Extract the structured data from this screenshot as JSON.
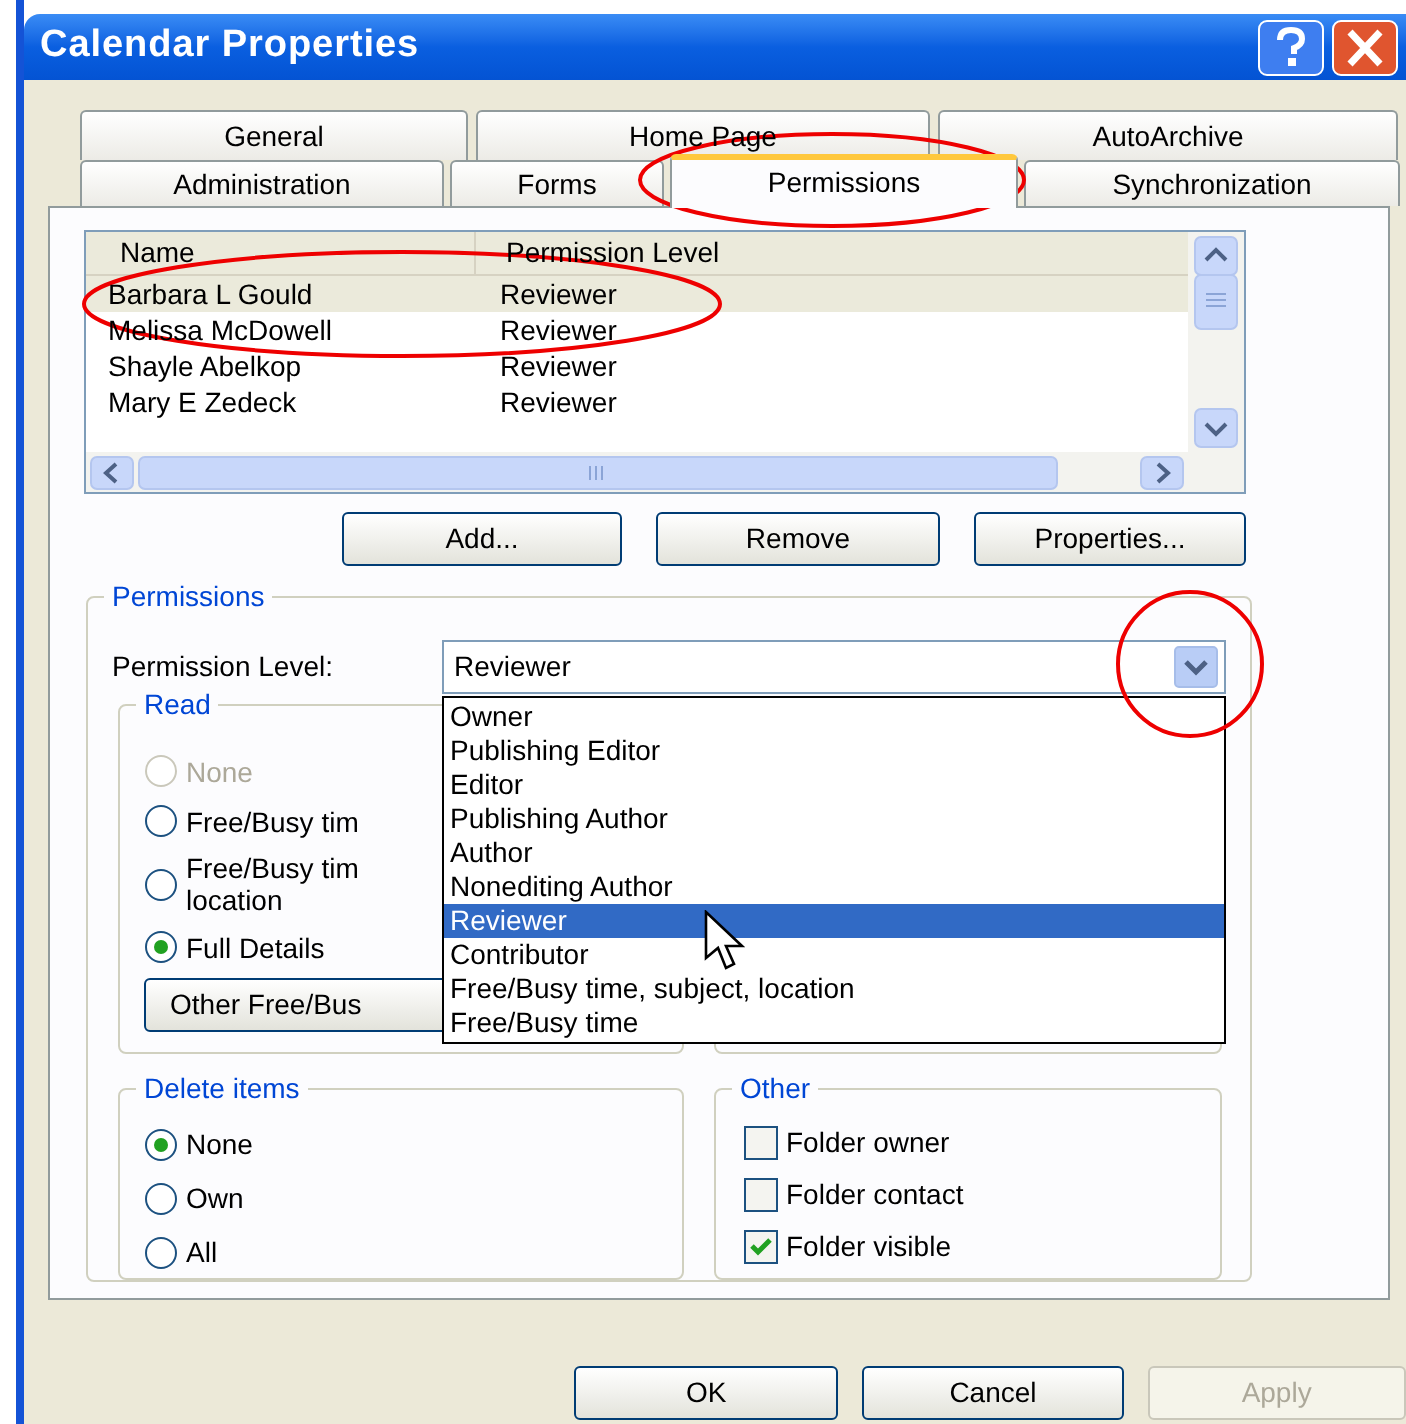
{
  "window": {
    "title": "Calendar Properties"
  },
  "tabs": [
    [
      {
        "label": "General",
        "selected": false
      },
      {
        "label": "Home Page",
        "selected": false
      },
      {
        "label": "AutoArchive",
        "selected": false
      }
    ],
    [
      {
        "label": "Administration",
        "selected": false
      },
      {
        "label": "Forms",
        "selected": false
      },
      {
        "label": "Permissions",
        "selected": true
      },
      {
        "label": "Synchronization",
        "selected": false
      }
    ]
  ],
  "member_list": {
    "columns": [
      "Name",
      "Permission Level"
    ],
    "rows": [
      {
        "name": "Barbara L Gould",
        "level": "Reviewer",
        "selected": true
      },
      {
        "name": "Melissa McDowell",
        "level": "Reviewer",
        "selected": false
      },
      {
        "name": "Shayle Abelkop",
        "level": "Reviewer",
        "selected": false
      },
      {
        "name": "Mary E Zedeck",
        "level": "Reviewer",
        "selected": false
      }
    ]
  },
  "list_buttons": [
    "Add...",
    "Remove",
    "Properties..."
  ],
  "permissions": {
    "title": "Permissions",
    "level_label": "Permission Level:",
    "level_value": "Reviewer",
    "dropdown": {
      "open": true,
      "options": [
        {
          "label": "Owner",
          "selected": false
        },
        {
          "label": "Publishing Editor",
          "selected": false
        },
        {
          "label": "Editor",
          "selected": false
        },
        {
          "label": "Publishing Author",
          "selected": false
        },
        {
          "label": "Author",
          "selected": false
        },
        {
          "label": "Nonediting Author",
          "selected": false
        },
        {
          "label": "Reviewer",
          "selected": true
        },
        {
          "label": "Contributor",
          "selected": false
        },
        {
          "label": "Free/Busy time, subject, location",
          "selected": false
        },
        {
          "label": "Free/Busy time",
          "selected": false
        }
      ]
    },
    "read": {
      "title": "Read",
      "options": [
        {
          "lines": [
            "None"
          ],
          "checked": false,
          "disabled": true
        },
        {
          "lines": [
            "Free/Busy tim"
          ],
          "checked": false,
          "disabled": false
        },
        {
          "lines": [
            "Free/Busy tim",
            "location"
          ],
          "checked": false,
          "disabled": false
        },
        {
          "lines": [
            "Full Details"
          ],
          "checked": true,
          "disabled": false
        }
      ],
      "button": "Other Free/Bus"
    },
    "delete_items": {
      "title": "Delete items",
      "options": [
        {
          "label": "None",
          "checked": true
        },
        {
          "label": "Own",
          "checked": false
        },
        {
          "label": "All",
          "checked": false
        }
      ]
    },
    "other": {
      "title": "Other",
      "options": [
        {
          "label": "Folder owner",
          "checked": false
        },
        {
          "label": "Folder contact",
          "checked": false
        },
        {
          "label": "Folder visible",
          "checked": true
        }
      ]
    }
  },
  "buttons": [
    {
      "label": "OK",
      "disabled": false
    },
    {
      "label": "Cancel",
      "disabled": false
    },
    {
      "label": "Apply",
      "disabled": true
    }
  ]
}
